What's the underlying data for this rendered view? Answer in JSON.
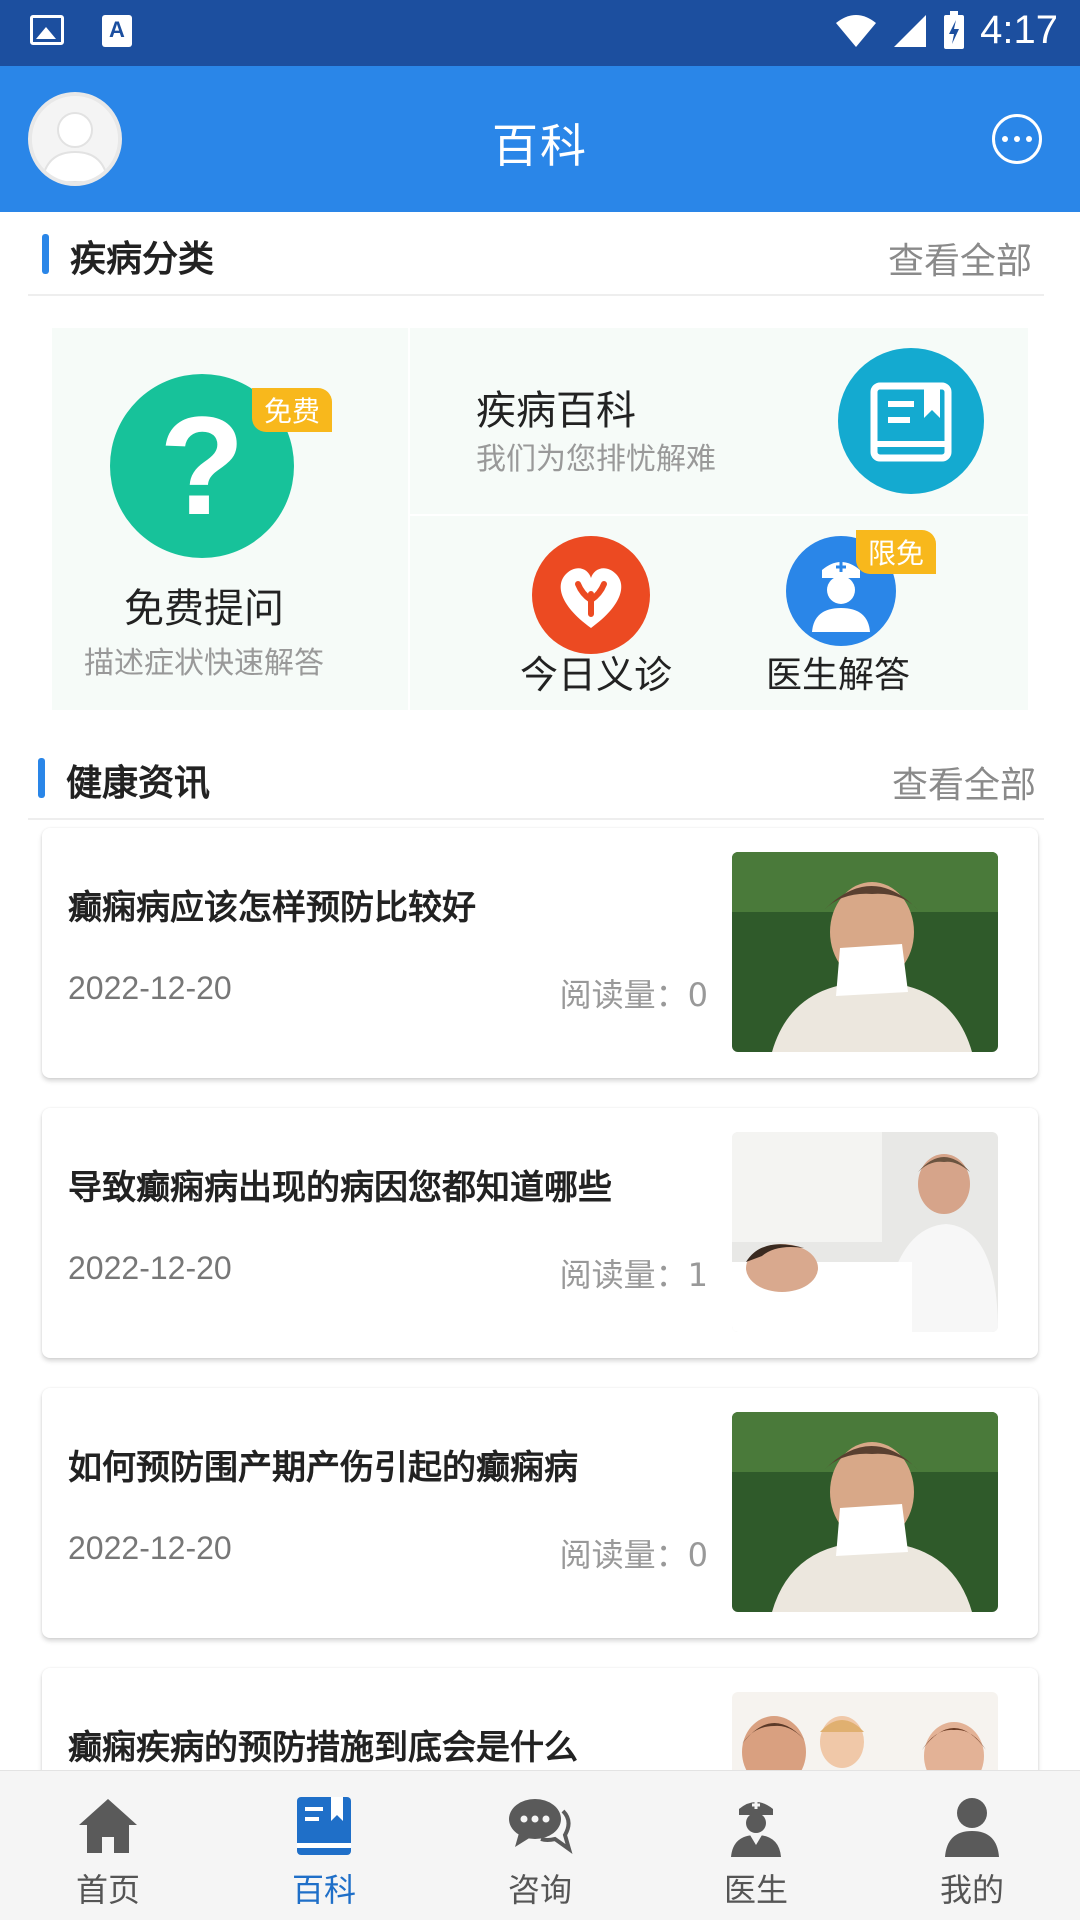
{
  "status_bar": {
    "time": "4:17"
  },
  "header": {
    "title": "百科"
  },
  "disease_section": {
    "title": "疾病分类",
    "view_all": "查看全部"
  },
  "categories": {
    "free_question": {
      "badge": "免费",
      "title": "免费提问",
      "subtitle": "描述症状快速解答"
    },
    "disease_wiki": {
      "title": "疾病百科",
      "subtitle": "我们为您排忧解难"
    },
    "today_clinic": {
      "label": "今日义诊"
    },
    "doctor_answer": {
      "badge": "限免",
      "label": "医生解答"
    }
  },
  "news_section": {
    "title": "健康资讯",
    "view_all": "查看全部"
  },
  "news": [
    {
      "title": "癫痫病应该怎样预防比较好",
      "date": "2022-12-20",
      "reads": "阅读量：0"
    },
    {
      "title": "导致癫痫病出现的病因您都知道哪些",
      "date": "2022-12-20",
      "reads": "阅读量：1"
    },
    {
      "title": "如何预防围产期产伤引起的癫痫病",
      "date": "2022-12-20",
      "reads": "阅读量：0"
    },
    {
      "title": "癫痫疾病的预防措施到底会是什么",
      "date": "",
      "reads": ""
    }
  ],
  "bottom_nav": [
    {
      "label": "首页",
      "icon": "home-icon",
      "active": false
    },
    {
      "label": "百科",
      "icon": "book-icon",
      "active": true
    },
    {
      "label": "咨询",
      "icon": "chat-icon",
      "active": false
    },
    {
      "label": "医生",
      "icon": "doctor-icon",
      "active": false
    },
    {
      "label": "我的",
      "icon": "user-icon",
      "active": false
    }
  ],
  "colors": {
    "primary": "#2a86e8",
    "status_bar": "#1c4f9f",
    "active_tab": "#1f6fc8",
    "badge": "#f8b81c"
  }
}
